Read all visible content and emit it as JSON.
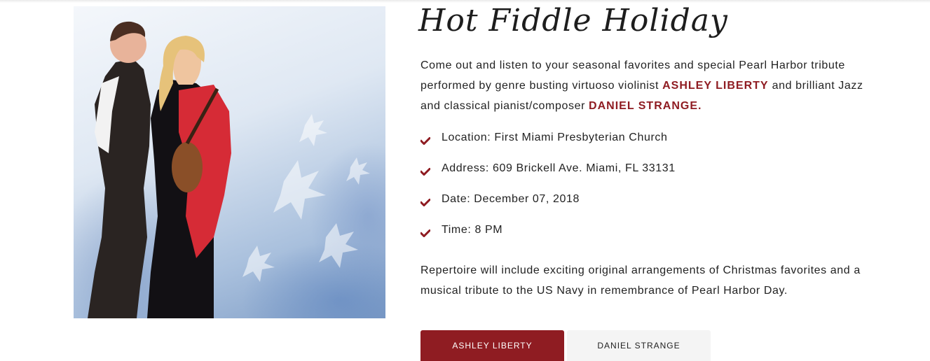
{
  "event": {
    "title": "Hot Fiddle Holiday",
    "intro_part1": "Come out and listen to your seasonal favorites and special Pearl Harbor tribute performed by genre busting virtuoso violinist ",
    "artist1": "ASHLEY LIBERTY",
    "intro_part2": " and brilliant Jazz and classical pianist/composer ",
    "artist2": "DANIEL STRANGE.",
    "details": [
      {
        "icon": "check-icon",
        "text": "Location: First Miami Presbyterian Church"
      },
      {
        "icon": "check-icon",
        "text": "Address: 609 Brickell Ave. Miami, FL 33131"
      },
      {
        "icon": "check-icon",
        "text": "Date: December 07, 2018"
      },
      {
        "icon": "check-icon",
        "text": "Time: 8 PM"
      }
    ],
    "repertoire": "Repertoire will include exciting original arrangements of Christmas favorites and a musical tribute to the US Navy in remembrance of Pearl Harbor Day."
  },
  "tabs": [
    {
      "label": "ASHLEY LIBERTY",
      "active": true
    },
    {
      "label": "DANIEL STRANGE",
      "active": false
    }
  ],
  "colors": {
    "accent": "#8f1c22",
    "inactive_tab": "#f4f4f4",
    "text": "#222222"
  }
}
